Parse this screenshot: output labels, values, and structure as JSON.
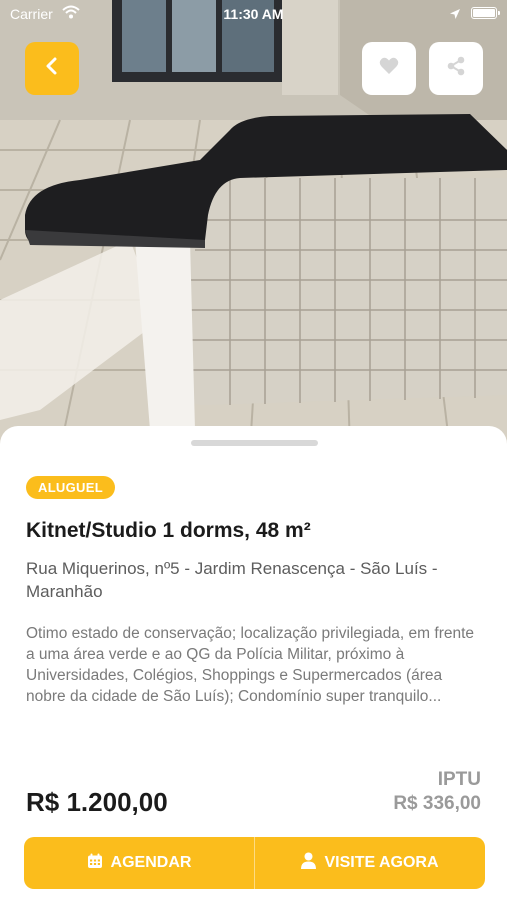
{
  "status_bar": {
    "carrier": "Carrier",
    "time": "11:30 AM"
  },
  "nav": {
    "back_icon": "chevron-left-icon",
    "favorite_icon": "heart-icon",
    "share_icon": "share-icon"
  },
  "listing": {
    "badge": "ALUGUEL",
    "title": "Kitnet/Studio 1 dorms, 48 m²",
    "address": "Rua Miquerinos, nº5 - Jardim Renascença - São Luís - Maranhão",
    "description": "Otimo estado de conservação; localização privilegiada, em frente a uma área verde e ao QG da Polícia Militar, próximo à Universidades, Colégios, Shoppings e Supermercados (área nobre da cidade de São Luís); Condomínio super tranquilo...",
    "price": "R$ 1.200,00",
    "iptu_label": "IPTU",
    "iptu_value": "R$ 336,00"
  },
  "actions": {
    "schedule_label": "AGENDAR",
    "schedule_icon": "calendar-icon",
    "visit_label": "VISITE AGORA",
    "visit_icon": "user-icon"
  },
  "colors": {
    "accent": "#fbbd1c",
    "text_dark": "#1b1b1b",
    "text_muted": "#7a7a7a"
  }
}
